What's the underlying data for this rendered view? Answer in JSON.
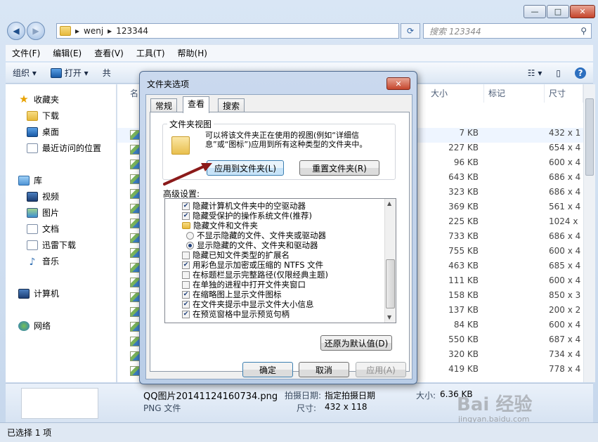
{
  "window": {
    "caption_min": "—",
    "caption_max": "□",
    "caption_close": "✕",
    "back": "◀",
    "forward": "▶",
    "address": {
      "crumbs": [
        "wenj",
        "123344"
      ],
      "sep": "▸"
    },
    "search_placeholder": "搜索 123344"
  },
  "menu": [
    "文件(F)",
    "编辑(E)",
    "查看(V)",
    "工具(T)",
    "帮助(H)"
  ],
  "toolbar": {
    "organize": "组织 ▾",
    "open": "打开 ▾",
    "share_partial": "共"
  },
  "nav": {
    "favorites": "收藏夹",
    "downloads": "下载",
    "desktop": "桌面",
    "recent": "最近访问的位置",
    "libraries": "库",
    "videos": "视频",
    "pictures": "图片",
    "documents": "文档",
    "thunder": "迅雷下载",
    "music": "音乐",
    "computer": "计算机",
    "network": "网络"
  },
  "columns": {
    "name_partial": "名",
    "size": "大小",
    "tags": "标记",
    "dims": "尺寸"
  },
  "files": [
    {
      "size": "7 KB",
      "dims": "432 x 1"
    },
    {
      "size": "227 KB",
      "dims": "654 x 4"
    },
    {
      "size": "96 KB",
      "dims": "600 x 4"
    },
    {
      "size": "643 KB",
      "dims": "686 x 4"
    },
    {
      "size": "323 KB",
      "dims": "686 x 4"
    },
    {
      "size": "369 KB",
      "dims": "561 x 4"
    },
    {
      "size": "225 KB",
      "dims": "1024 x"
    },
    {
      "size": "733 KB",
      "dims": "686 x 4"
    },
    {
      "size": "755 KB",
      "dims": "600 x 4"
    },
    {
      "size": "463 KB",
      "dims": "685 x 4"
    },
    {
      "size": "111 KB",
      "dims": "600 x 4"
    },
    {
      "size": "158 KB",
      "dims": "850 x 3"
    },
    {
      "size": "137 KB",
      "dims": "200 x 2"
    },
    {
      "size": "84 KB",
      "dims": "600 x 4"
    },
    {
      "size": "550 KB",
      "dims": "687 x 4"
    },
    {
      "size": "320 KB",
      "dims": "734 x 4"
    },
    {
      "size": "419 KB",
      "dims": "778 x 4"
    }
  ],
  "details": {
    "filename": "QQ图片20141124160734.png",
    "type": "PNG 文件",
    "date_label": "拍摄日期:",
    "date_value": "指定拍摄日期",
    "size_label": "大小:",
    "size_value": "6.36 KB",
    "dims_label": "尺寸:",
    "dims_value": "432 x 118"
  },
  "status": "已选择 1 项",
  "dialog": {
    "title": "文件夹选项",
    "tabs": [
      "常规",
      "查看",
      "搜索"
    ],
    "group_title": "文件夹视图",
    "group_desc": "可以将该文件夹正在使用的视图(例如“详细信息”或“图标”)应用到所有这种类型的文件夹中。",
    "apply_to_folders": "应用到文件夹(L)",
    "reset_folders": "重置文件夹(R)",
    "advanced_label": "高级设置:",
    "options": [
      {
        "label": "隐藏计算机文件夹中的空驱动器",
        "kind": "check",
        "checked": true
      },
      {
        "label": "隐藏受保护的操作系统文件(推荐)",
        "kind": "check",
        "checked": true
      },
      {
        "label": "隐藏文件和文件夹",
        "kind": "folder"
      },
      {
        "label": "不显示隐藏的文件、文件夹或驱动器",
        "kind": "radio",
        "checked": false
      },
      {
        "label": "显示隐藏的文件、文件夹和驱动器",
        "kind": "radio",
        "checked": true
      },
      {
        "label": "隐藏已知文件类型的扩展名",
        "kind": "check",
        "checked": false
      },
      {
        "label": "用彩色显示加密或压缩的 NTFS 文件",
        "kind": "check",
        "checked": true
      },
      {
        "label": "在标题栏显示完整路径(仅限经典主题)",
        "kind": "check",
        "checked": false
      },
      {
        "label": "在单独的进程中打开文件夹窗口",
        "kind": "check",
        "checked": false
      },
      {
        "label": "在缩略图上显示文件图标",
        "kind": "check",
        "checked": true
      },
      {
        "label": "在文件夹提示中显示文件大小信息",
        "kind": "check",
        "checked": true
      },
      {
        "label": "在预览窗格中显示预览句柄",
        "kind": "check",
        "checked": true
      }
    ],
    "restore_defaults": "还原为默认值(D)",
    "ok": "确定",
    "cancel": "取消",
    "apply": "应用(A)"
  },
  "watermark": {
    "text": "Bai 经验",
    "sub": "jingyan.baidu.com"
  },
  "colors": {
    "accent": "#3c7fb1",
    "arrow": "#8b1a1a"
  }
}
